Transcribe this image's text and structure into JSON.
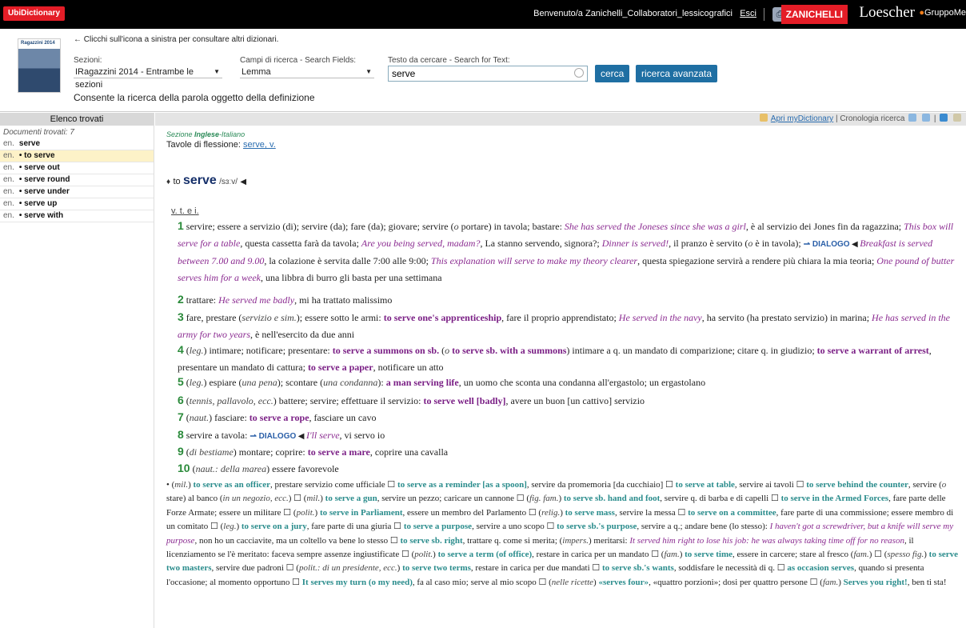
{
  "topbar": {
    "brand": "UbiDictionary",
    "welcome": "Benvenuto/a Zanichelli_Collaboratori_lessicografici",
    "exit": "Esci",
    "publisher1": "ZANICHELLI",
    "publisher2": "Loescher",
    "publisher3_prefix": "Gruppo",
    "publisher3_suffix": "Me",
    "colors": {
      "brand_red": "#e41d27",
      "bar": "#000000"
    }
  },
  "header": {
    "cover_title": "Ragazzini 2014",
    "hint": "← Clicchi sull'icona a sinistra per consultare altri dizionari.",
    "sections_label": "Sezioni:",
    "sections_value": "IRagazzini 2014 - Entrambe le sezioni",
    "fields_label": "Campi di ricerca - Search Fields:",
    "fields_value": "Lemma",
    "search_label": "Testo da cercare - Search for Text:",
    "search_value": "serve",
    "search_button": "cerca",
    "advanced_button": "ricerca avanzata",
    "advanced_desc": "Consente la ricerca della parola oggetto della definizione"
  },
  "left": {
    "title": "Elenco trovati",
    "doc_count": "Documenti trovati: 7",
    "results": [
      {
        "lang": "en.",
        "label": "serve",
        "bullet": false
      },
      {
        "lang": "en.",
        "label": "to serve",
        "bullet": true
      },
      {
        "lang": "en.",
        "label": "serve out",
        "bullet": true
      },
      {
        "lang": "en.",
        "label": "serve round",
        "bullet": true
      },
      {
        "lang": "en.",
        "label": "serve under",
        "bullet": true
      },
      {
        "lang": "en.",
        "label": "serve up",
        "bullet": true
      },
      {
        "lang": "en.",
        "label": "serve with",
        "bullet": true
      }
    ]
  },
  "toolbar": {
    "open_link": "Apri myDictionary",
    "history": "Cronologia ricerca"
  },
  "entry": {
    "section_prefix": "Sezione",
    "section_name": "Inglese",
    "section_suffix": "-Italiano",
    "inflection_label": "Tavole di flessione:",
    "inflection_link": "serve, v.",
    "head_prefix": "to",
    "headword": "serve",
    "pron": "/sɜːv/",
    "pos": "v. t. e i.",
    "dialog_label": "Dialogo",
    "senses": [
      {
        "n": "1",
        "parts": [
          [
            "t",
            "servire; essere a servizio (di); servire (da); fare (da); giovare; servire ("
          ],
          [
            "l",
            "o"
          ],
          [
            "t",
            " portare) in tavola; bastare: "
          ],
          [
            "e",
            "She has served the Joneses since she was a girl"
          ],
          [
            "t",
            ", è al servizio dei Jones fin da ragazzina; "
          ],
          [
            "e",
            "This box will serve for a table"
          ],
          [
            "t",
            ", questa cassetta farà da tavola; "
          ],
          [
            "e",
            "Are you being served, madam?"
          ],
          [
            "t",
            ", La stanno servendo, signora?; "
          ],
          [
            "e",
            "Dinner is served!"
          ],
          [
            "t",
            ", il pranzo è servito ("
          ],
          [
            "l",
            "o"
          ],
          [
            "t",
            " è in tavola); "
          ],
          [
            "d",
            "⇀ DIALOGO"
          ],
          [
            "s",
            " ◀ "
          ],
          [
            "e",
            "Breakfast is served between 7.00 and 9.00"
          ],
          [
            "t",
            ", la colazione è servita dalle 7:00 alle 9:00; "
          ],
          [
            "e",
            "This explanation will serve to make my theory clearer"
          ],
          [
            "t",
            ", questa spiegazione servirà a rendere più chiara la mia teoria; "
          ],
          [
            "e",
            "One pound of butter serves him for a week"
          ],
          [
            "t",
            ", una libbra di burro gli basta per una settimana"
          ]
        ]
      },
      {
        "n": "2",
        "parts": [
          [
            "t",
            "trattare: "
          ],
          [
            "e",
            "He served me badly"
          ],
          [
            "t",
            ", mi ha trattato malissimo"
          ]
        ]
      },
      {
        "n": "3",
        "parts": [
          [
            "t",
            "fare, prestare ("
          ],
          [
            "l",
            "servizio e sim."
          ],
          [
            "t",
            "); essere sotto le armi: "
          ],
          [
            "p",
            "to serve one's apprenticeship"
          ],
          [
            "t",
            ", fare il proprio apprendistato; "
          ],
          [
            "e",
            "He served in the navy"
          ],
          [
            "t",
            ", ha servito (ha prestato servizio) in marina; "
          ],
          [
            "e",
            "He has served in the army for two years"
          ],
          [
            "t",
            ", è nell'esercito da due anni"
          ]
        ]
      },
      {
        "n": "4",
        "parts": [
          [
            "t",
            "("
          ],
          [
            "l",
            "leg."
          ],
          [
            "t",
            ") intimare; notificare; presentare: "
          ],
          [
            "p",
            "to serve a summons on sb."
          ],
          [
            "t",
            " ("
          ],
          [
            "l",
            "o"
          ],
          [
            "t",
            " "
          ],
          [
            "p",
            "to serve sb. with a summons"
          ],
          [
            "t",
            ") intimare a q. un mandato di comparizione; citare q. in giudizio; "
          ],
          [
            "p",
            "to serve a warrant of arrest"
          ],
          [
            "t",
            ", presentare un mandato di cattura; "
          ],
          [
            "p",
            "to serve a paper"
          ],
          [
            "t",
            ", notificare un atto"
          ]
        ]
      },
      {
        "n": "5",
        "parts": [
          [
            "t",
            "("
          ],
          [
            "l",
            "leg."
          ],
          [
            "t",
            ") espiare ("
          ],
          [
            "l",
            "una pena"
          ],
          [
            "t",
            "); scontare ("
          ],
          [
            "l",
            "una condanna"
          ],
          [
            "t",
            "): "
          ],
          [
            "p",
            "a man serving life"
          ],
          [
            "t",
            ", un uomo che sconta una condanna all'ergastolo; un ergastolano"
          ]
        ]
      },
      {
        "n": "6",
        "parts": [
          [
            "t",
            "("
          ],
          [
            "l",
            "tennis, pallavolo, ecc."
          ],
          [
            "t",
            ") battere; servire; effettuare il servizio: "
          ],
          [
            "p",
            "to serve well [badly]"
          ],
          [
            "t",
            ", avere un buon [un cattivo] servizio"
          ]
        ]
      },
      {
        "n": "7",
        "parts": [
          [
            "t",
            "("
          ],
          [
            "l",
            "naut."
          ],
          [
            "t",
            ") fasciare: "
          ],
          [
            "p",
            "to serve a rope"
          ],
          [
            "t",
            ", fasciare un cavo"
          ]
        ]
      },
      {
        "n": "8",
        "parts": [
          [
            "t",
            "servire a tavola: "
          ],
          [
            "d",
            "⇀ DIALOGO"
          ],
          [
            "s",
            " ◀ "
          ],
          [
            "e",
            "I'll serve"
          ],
          [
            "t",
            ", vi servo io"
          ]
        ]
      },
      {
        "n": "9",
        "parts": [
          [
            "t",
            "("
          ],
          [
            "l",
            "di bestiame"
          ],
          [
            "t",
            ") montare; coprire: "
          ],
          [
            "p",
            "to serve a mare"
          ],
          [
            "t",
            ", coprire una cavalla"
          ]
        ]
      },
      {
        "n": "10",
        "parts": [
          [
            "t",
            "("
          ],
          [
            "l",
            "naut.: della marea"
          ],
          [
            "t",
            ") essere favorevole"
          ]
        ]
      }
    ],
    "idioms": [
      [
        "t",
        "• ("
      ],
      [
        "l",
        "mil."
      ],
      [
        "t",
        ") "
      ],
      [
        "p",
        "to serve as an officer"
      ],
      [
        "t",
        ", prestare servizio come ufficiale ☐ "
      ],
      [
        "p",
        "to serve as a reminder [as a spoon]"
      ],
      [
        "t",
        ", servire da promemoria [da cucchiaio] ☐ "
      ],
      [
        "p",
        "to serve at table"
      ],
      [
        "t",
        ", servire ai tavoli ☐ "
      ],
      [
        "p",
        "to serve behind the counter"
      ],
      [
        "t",
        ", servire ("
      ],
      [
        "l",
        "o"
      ],
      [
        "t",
        " stare) al banco ("
      ],
      [
        "l",
        "in un negozio, ecc."
      ],
      [
        "t",
        ") ☐ ("
      ],
      [
        "l",
        "mil."
      ],
      [
        "t",
        ") "
      ],
      [
        "p",
        "to serve a gun"
      ],
      [
        "t",
        ", servire un pezzo; caricare un cannone ☐ ("
      ],
      [
        "l",
        "fig. fam."
      ],
      [
        "t",
        ") "
      ],
      [
        "p",
        "to serve sb. hand and foot"
      ],
      [
        "t",
        ", servire q. di barba e di capelli ☐ "
      ],
      [
        "p",
        "to serve in the Armed Forces"
      ],
      [
        "t",
        ", fare parte delle Forze Armate; essere un militare ☐ ("
      ],
      [
        "l",
        "polit."
      ],
      [
        "t",
        ") "
      ],
      [
        "p",
        "to serve in Parliament"
      ],
      [
        "t",
        ", essere un membro del Parlamento ☐ ("
      ],
      [
        "l",
        "relig."
      ],
      [
        "t",
        ") "
      ],
      [
        "p",
        "to serve mass"
      ],
      [
        "t",
        ", servire la messa ☐ "
      ],
      [
        "p",
        "to serve on a committee"
      ],
      [
        "t",
        ", fare parte di una commissione; essere membro di un comitato ☐ ("
      ],
      [
        "l",
        "leg."
      ],
      [
        "t",
        ") "
      ],
      [
        "p",
        "to serve on a jury"
      ],
      [
        "t",
        ", fare parte di una giuria ☐ "
      ],
      [
        "p",
        "to serve a purpose"
      ],
      [
        "t",
        ", servire a uno scopo ☐ "
      ],
      [
        "p",
        "to serve sb.'s purpose"
      ],
      [
        "t",
        ", servire a q.; andare bene (lo stesso): "
      ],
      [
        "e",
        "I haven't got a screwdriver, but a knife will serve my purpose"
      ],
      [
        "t",
        ", non ho un cacciavite, ma un coltello va bene lo stesso ☐ "
      ],
      [
        "p",
        "to serve sb. right"
      ],
      [
        "t",
        ", trattare q. come si merita; ("
      ],
      [
        "l",
        "impers."
      ],
      [
        "t",
        ") meritarsi: "
      ],
      [
        "e",
        "It served him right to lose his job: he was always taking time off for no reason"
      ],
      [
        "t",
        ", il licenziamento se l'è meritato: faceva sempre assenze ingiustificate ☐ ("
      ],
      [
        "l",
        "polit."
      ],
      [
        "t",
        ") "
      ],
      [
        "p",
        "to serve a term (of office)"
      ],
      [
        "t",
        ", restare in carica per un mandato ☐ ("
      ],
      [
        "l",
        "fam."
      ],
      [
        "t",
        ") "
      ],
      [
        "p",
        "to serve time"
      ],
      [
        "t",
        ", essere in carcere; stare al fresco ("
      ],
      [
        "l",
        "fam."
      ],
      [
        "t",
        ") ☐ ("
      ],
      [
        "l",
        "spesso fig."
      ],
      [
        "t",
        ") "
      ],
      [
        "p",
        "to serve two masters"
      ],
      [
        "t",
        ", servire due padroni ☐ ("
      ],
      [
        "l",
        "polit.: di un presidente, ecc."
      ],
      [
        "t",
        ") "
      ],
      [
        "p",
        "to serve two terms"
      ],
      [
        "t",
        ", restare in carica per due mandati ☐ "
      ],
      [
        "p",
        "to serve sb.'s wants"
      ],
      [
        "t",
        ", soddisfare le necessità di q. ☐ "
      ],
      [
        "p",
        "as occasion serves"
      ],
      [
        "t",
        ", quando si presenta l'occasione; al momento opportuno ☐ "
      ],
      [
        "p",
        "It serves my turn (o my need)"
      ],
      [
        "t",
        ", fa al caso mio; serve al mio scopo ☐ ("
      ],
      [
        "l",
        "nelle ricette"
      ],
      [
        "t",
        ") "
      ],
      [
        "p",
        "«serves four»"
      ],
      [
        "t",
        ", «quattro porzioni»; dosi per quattro persone ☐ ("
      ],
      [
        "l",
        "fam."
      ],
      [
        "t",
        ") "
      ],
      [
        "p",
        "Serves you right!"
      ],
      [
        "t",
        ", ben ti sta!"
      ]
    ]
  }
}
